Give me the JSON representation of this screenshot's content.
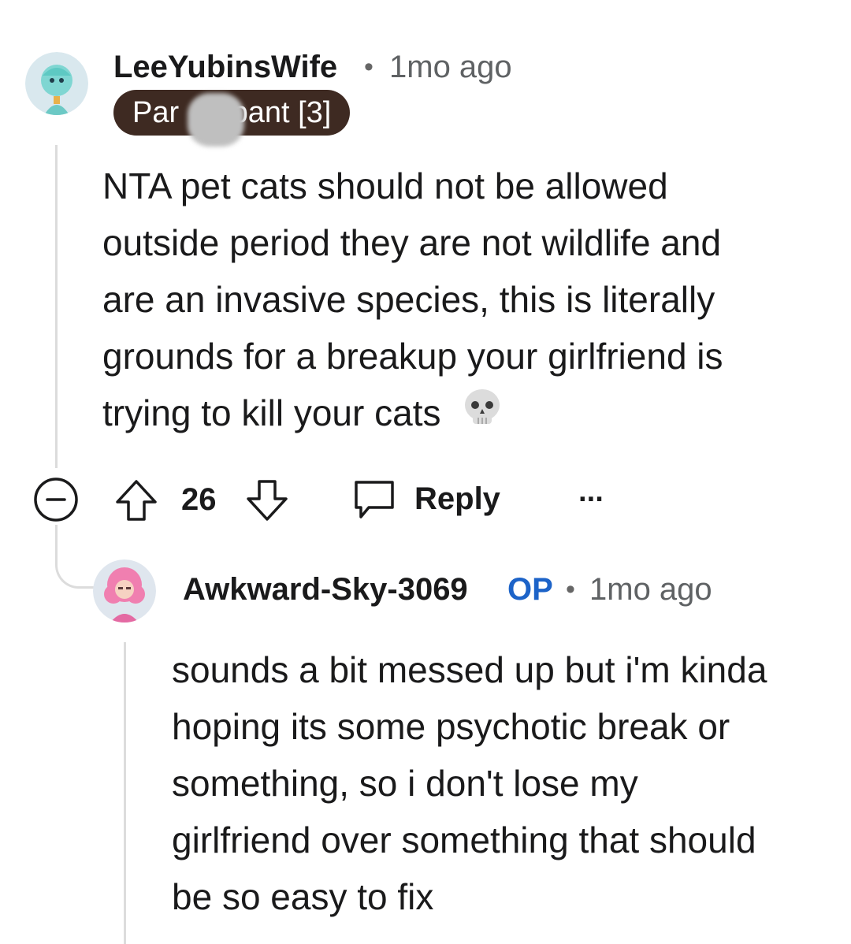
{
  "comment": {
    "author": "LeeYubinsWife",
    "time": "1mo ago",
    "flair": "Participant [3]",
    "flair_visible_left": "Par",
    "flair_visible_right": "ipant [3]",
    "body_lines": [
      "NTA pet cats should not be allowed",
      "outside period they are not wildlife and",
      "are an invasive species, this is literally",
      "grounds for a breakup your girlfriend is",
      "trying to kill your cats"
    ],
    "emoji": "💀",
    "votes": "26",
    "reply_label": "Reply",
    "more_label": "···"
  },
  "reply": {
    "author": "Awkward-Sky-3069",
    "op_label": "OP",
    "time": "1mo ago",
    "body_lines": [
      "sounds a bit messed up but i'm kinda",
      "hoping its some psychotic break or",
      "something, so i don't lose my",
      "girlfriend over something that should",
      "be so easy to fix"
    ]
  },
  "icons": {
    "collapse": "collapse-icon",
    "upvote": "upvote-icon",
    "downvote": "downvote-icon",
    "reply": "reply-icon",
    "more": "more-icon"
  },
  "colors": {
    "flair_bg": "#3e2a22",
    "op": "#1c63c8",
    "thread_line": "#dcdcdc"
  }
}
